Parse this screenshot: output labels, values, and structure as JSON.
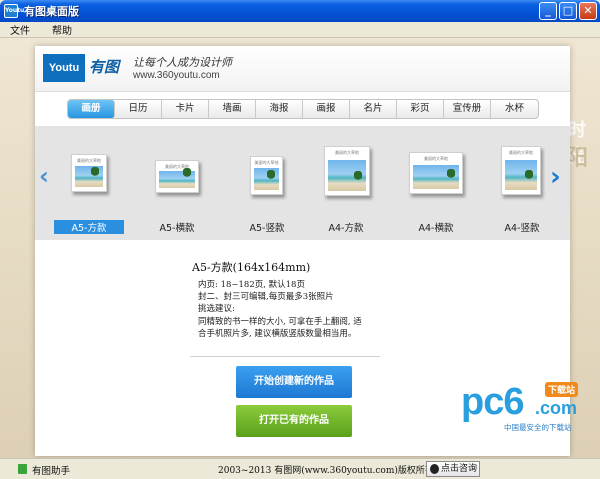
{
  "window": {
    "title": "有图桌面版",
    "icon_label": "Youtu",
    "buttons": {
      "minimize": "_",
      "maximize": "□",
      "close": "✕"
    }
  },
  "menu": [
    "文件",
    "帮助"
  ],
  "background": {
    "text1": "时光",
    "text2": "阳"
  },
  "header": {
    "logo_text": "Youtu",
    "logo_cn": "有图",
    "slogan": "让每个人成为设计师",
    "url": "www.360youtu.com"
  },
  "tabs": [
    "画册",
    "日历",
    "卡片",
    "墙画",
    "海报",
    "画报",
    "名片",
    "彩页",
    "宣传册",
    "水杯"
  ],
  "active_tab": 0,
  "products": [
    {
      "label": "A5-方款",
      "selected": true,
      "cover_caption": "美丽的大草地"
    },
    {
      "label": "A5-横款",
      "selected": false,
      "cover_caption": "美丽的大草地"
    },
    {
      "label": "A5-竖款",
      "selected": false,
      "cover_caption": "美丽的大草地"
    },
    {
      "label": "A4-方款",
      "selected": false,
      "cover_caption": "美丽的大草地"
    },
    {
      "label": "A4-横款",
      "selected": false,
      "cover_caption": "美丽的大草地"
    },
    {
      "label": "A4-竖款",
      "selected": false,
      "cover_caption": "美丽的大草地"
    }
  ],
  "detail": {
    "title": "A5-方款(164x164mm)",
    "lines": [
      "内页: 18~182页, 默认18页",
      "封二、封三可编辑,每页最多3张照片",
      "挑选建议:",
      "同精致的书一样的大小, 可拿在手上翻阅, 适",
      "合手机照片多, 建议横版竖版数量相当用。"
    ]
  },
  "actions": {
    "create": "开始创建新的作品",
    "open": "打开已有的作品"
  },
  "watermark": {
    "brand": "pc6",
    "domain": ".com",
    "badge": "下载站",
    "tagline": "中国最安全的下载站"
  },
  "statusbar": {
    "helper": "有图助手",
    "copyright": "2003~2013 有图网(www.360youtu.com)版权所有",
    "consult": "点击咨询"
  }
}
